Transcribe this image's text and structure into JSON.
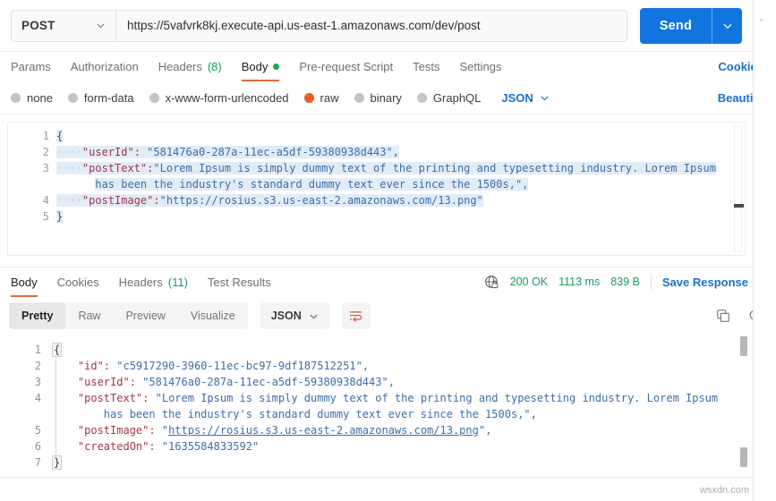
{
  "request": {
    "method": "POST",
    "url": "https://5vafvrk8kj.execute-api.us-east-1.amazonaws.com/dev/post",
    "send_label": "Send",
    "tabs": [
      {
        "label": "Params",
        "badge": ""
      },
      {
        "label": "Authorization",
        "badge": ""
      },
      {
        "label": "Headers",
        "badge": "(8)"
      },
      {
        "label": "Body",
        "badge": ""
      },
      {
        "label": "Pre-request Script",
        "badge": ""
      },
      {
        "label": "Tests",
        "badge": ""
      },
      {
        "label": "Settings",
        "badge": ""
      }
    ],
    "cookies_label": "Cookies",
    "body_types": [
      "none",
      "form-data",
      "x-www-form-urlencoded",
      "raw",
      "binary",
      "GraphQL"
    ],
    "selected_body_type": "raw",
    "format": "JSON",
    "beautify_label": "Beautify",
    "editor": {
      "line_numbers": [
        "1",
        "2",
        "3",
        "4",
        "5"
      ],
      "l1": "{",
      "l2_key": "\"userId\":",
      "l2_val": " \"581476a0-287a-11ec-a5df-59380938d443\",",
      "l3_key": "\"postText\":",
      "l3_val": "\"Lorem Ipsum is simply dummy text of the printing and typesetting industry. Lorem Ipsum",
      "l3_cont": "has been the industry's standard dummy text ever since the 1500s,\",",
      "l4_key": "\"postImage\":",
      "l4_val": "\"https://rosius.s3.us-east-2.amazonaws.com/13.png\"",
      "l5": "}",
      "indent": "····"
    }
  },
  "response": {
    "tabs": [
      {
        "label": "Body",
        "badge": ""
      },
      {
        "label": "Cookies",
        "badge": ""
      },
      {
        "label": "Headers",
        "badge": "(11)"
      },
      {
        "label": "Test Results",
        "badge": ""
      }
    ],
    "status": "200 OK",
    "time": "1113 ms",
    "size": "839 B",
    "save_response_label": "Save Response",
    "view_modes": [
      "Pretty",
      "Raw",
      "Preview",
      "Visualize"
    ],
    "selected_view": "Pretty",
    "format": "JSON",
    "body": {
      "line_numbers": [
        "1",
        "2",
        "3",
        "4",
        "5",
        "6",
        "7"
      ],
      "l1": "{",
      "l2_key": "\"id\":",
      "l2_val": " \"c5917290-3960-11ec-bc97-9df187512251\",",
      "l3_key": "\"userId\":",
      "l3_val": " \"581476a0-287a-11ec-a5df-59380938d443\",",
      "l4_key": "\"postText\":",
      "l4_val": " \"Lorem Ipsum is simply dummy text of the printing and typesetting industry. Lorem Ipsum",
      "l4_cont": "has been the industry's standard dummy text ever since the 1500s,\",",
      "l5_key": "\"postImage\":",
      "l5_open": " \"",
      "l5_link": "https://rosius.s3.us-east-2.amazonaws.com/13.png",
      "l5_close": "\",",
      "l6_key": "\"createdOn\":",
      "l6_val": " \"1635584833592\"",
      "l7": "}"
    }
  },
  "watermark": "wsxdn.com",
  "colors": {
    "accent_blue": "#1175e0",
    "link_blue": "#1a6fd0",
    "orange": "#e06c39",
    "green": "#169c5d",
    "raw_dot": "#f05a28",
    "key": "#a3344a",
    "string": "#3c6ea8"
  }
}
